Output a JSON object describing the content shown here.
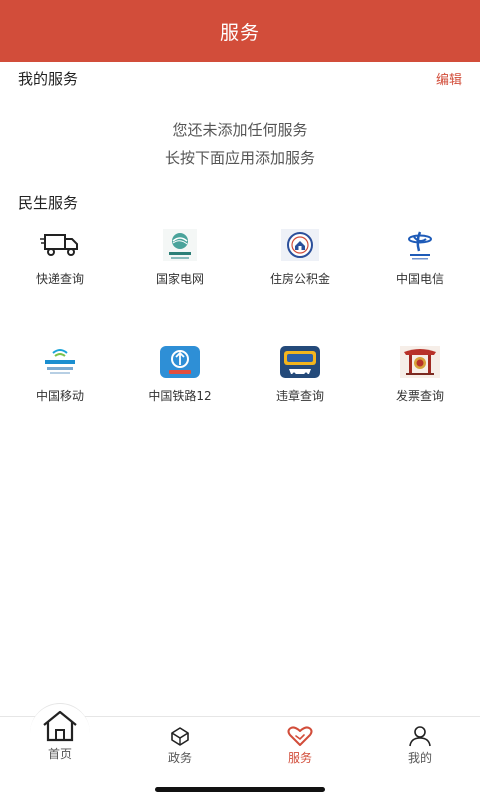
{
  "header": {
    "title": "服务"
  },
  "my_services": {
    "label": "我的服务",
    "edit": "编辑",
    "empty_line1": "您还未添加任何服务",
    "empty_line2": "长按下面应用添加服务"
  },
  "people_services": {
    "label": "民生服务",
    "items": [
      {
        "label": "快递查询",
        "icon": "delivery-truck-icon"
      },
      {
        "label": "国家电网",
        "icon": "state-grid-icon"
      },
      {
        "label": "住房公积金",
        "icon": "housing-fund-icon"
      },
      {
        "label": "中国电信",
        "icon": "china-telecom-icon"
      },
      {
        "label": "中国移动",
        "icon": "china-mobile-icon"
      },
      {
        "label": "中国铁路12",
        "icon": "china-railway-icon"
      },
      {
        "label": "违章查询",
        "icon": "traffic-violation-icon"
      },
      {
        "label": "发票查询",
        "icon": "invoice-icon"
      }
    ]
  },
  "tabbar": {
    "items": [
      {
        "label": "首页",
        "icon": "home-icon"
      },
      {
        "label": "政务",
        "icon": "government-icon"
      },
      {
        "label": "服务",
        "icon": "heart-icon",
        "active": true
      },
      {
        "label": "我的",
        "icon": "user-icon"
      }
    ]
  },
  "colors": {
    "accent": "#d24d3a"
  }
}
